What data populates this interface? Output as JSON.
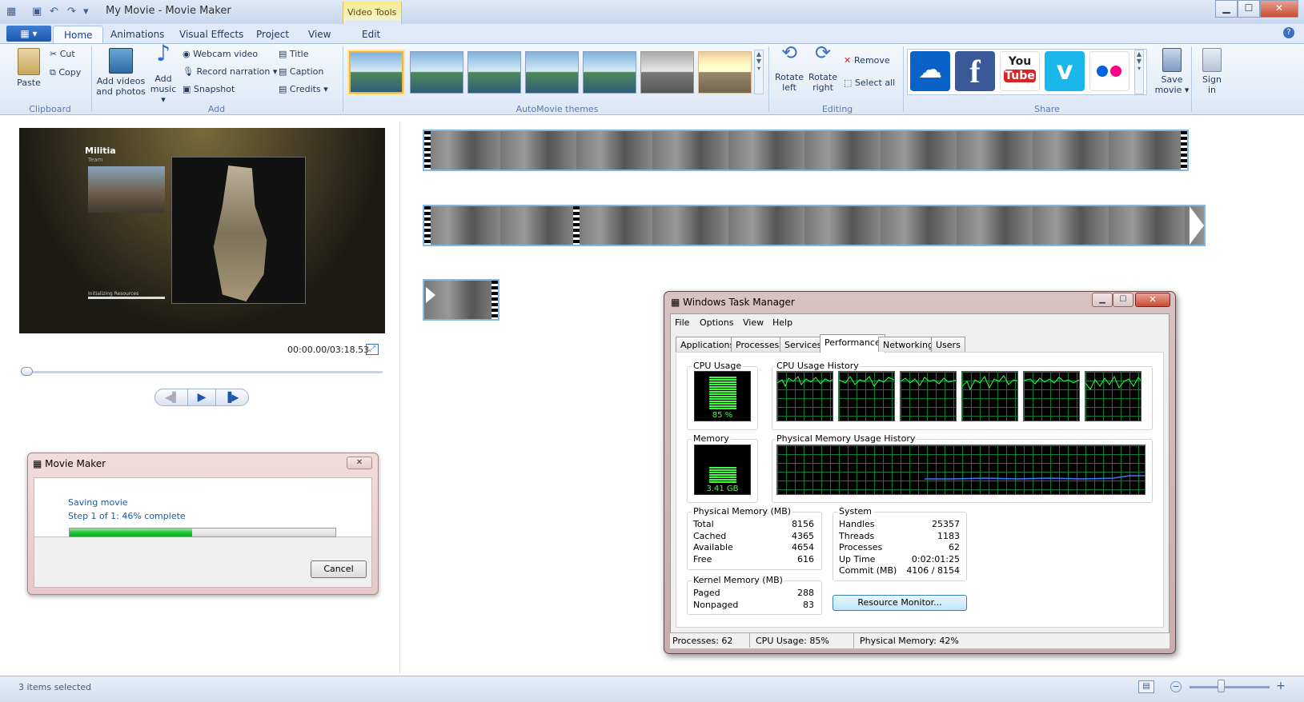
{
  "window": {
    "title": "My Movie - Movie Maker",
    "minimize": "▁",
    "maximize": "☐",
    "close": "✕"
  },
  "ribbon": {
    "file_menu_label": "▦ ▾",
    "tabs": [
      {
        "label": "Home",
        "active": true
      },
      {
        "label": "Animations"
      },
      {
        "label": "Visual Effects"
      },
      {
        "label": "Project"
      },
      {
        "label": "View"
      }
    ],
    "context": {
      "header": "Video Tools",
      "tab": "Edit"
    },
    "clipboard": {
      "paste": "Paste",
      "cut": "Cut",
      "copy": "Copy",
      "group": "Clipboard"
    },
    "add": {
      "add_videos_line1": "Add videos",
      "add_videos_line2": "and photos",
      "add_music_line1": "Add",
      "add_music_line2": "music ▾",
      "webcam": "Webcam video",
      "narration": "Record narration ▾",
      "snapshot": "Snapshot",
      "title": "Title",
      "caption": "Caption",
      "credits": "Credits ▾",
      "group": "Add"
    },
    "themes": {
      "group": "AutoMovie themes",
      "count": 7
    },
    "editing": {
      "rotate_left_line1": "Rotate",
      "rotate_left_line2": "left",
      "rotate_right_line1": "Rotate",
      "rotate_right_line2": "right",
      "remove": "Remove",
      "select_all": "Select all",
      "group": "Editing"
    },
    "share": {
      "services": [
        "SkyDrive",
        "Facebook",
        "YouTube",
        "Vimeo",
        "Flickr"
      ],
      "save_line1": "Save",
      "save_line2": "movie ▾",
      "signin_line1": "Sign",
      "signin_line2": "in",
      "group": "Share"
    }
  },
  "player": {
    "preview": {
      "map_name": "Militia",
      "subtitle": "Team",
      "loading": "Initializing Resources"
    },
    "timecode": "00:00.00/03:18.53",
    "progress": 0.0
  },
  "save_dialog": {
    "title": "Movie Maker",
    "line1": "Saving movie",
    "line2": "Step 1 of 1: 46% complete",
    "progress": 0.46,
    "cancel": "Cancel",
    "close": "✕"
  },
  "task_manager": {
    "title": "Windows Task Manager",
    "menu": [
      "File",
      "Options",
      "View",
      "Help"
    ],
    "tabs": [
      {
        "label": "Applications"
      },
      {
        "label": "Processes"
      },
      {
        "label": "Services"
      },
      {
        "label": "Performance",
        "active": true
      },
      {
        "label": "Networking"
      },
      {
        "label": "Users"
      }
    ],
    "cpu_usage_label": "CPU Usage",
    "cpu_usage_value": "85 %",
    "cpu_usage_level": 0.85,
    "cpu_history_label": "CPU Usage History",
    "memory_label": "Memory",
    "memory_value": "3.41 GB",
    "memory_level": 0.42,
    "memory_history_label": "Physical Memory Usage History",
    "physical_memory": {
      "heading": "Physical Memory (MB)",
      "rows": [
        {
          "label": "Total",
          "value": "8156"
        },
        {
          "label": "Cached",
          "value": "4365"
        },
        {
          "label": "Available",
          "value": "4654"
        },
        {
          "label": "Free",
          "value": "616"
        }
      ]
    },
    "kernel_memory": {
      "heading": "Kernel Memory (MB)",
      "rows": [
        {
          "label": "Paged",
          "value": "288"
        },
        {
          "label": "Nonpaged",
          "value": "83"
        }
      ]
    },
    "system": {
      "heading": "System",
      "rows": [
        {
          "label": "Handles",
          "value": "25357"
        },
        {
          "label": "Threads",
          "value": "1183"
        },
        {
          "label": "Processes",
          "value": "62"
        },
        {
          "label": "Up Time",
          "value": "0:02:01:25"
        },
        {
          "label": "Commit (MB)",
          "value": "4106 / 8154"
        }
      ]
    },
    "resource_monitor": "Resource Monitor...",
    "status": {
      "processes": "Processes: 62",
      "cpu": "CPU Usage: 85%",
      "memory": "Physical Memory: 42%"
    }
  },
  "statusbar": {
    "text": "3 items selected"
  },
  "colors": {
    "accent": "#1c56ad",
    "progress_green": "#22c33a",
    "graph_green": "#3cff3c",
    "graph_blue": "#3a7bff"
  }
}
